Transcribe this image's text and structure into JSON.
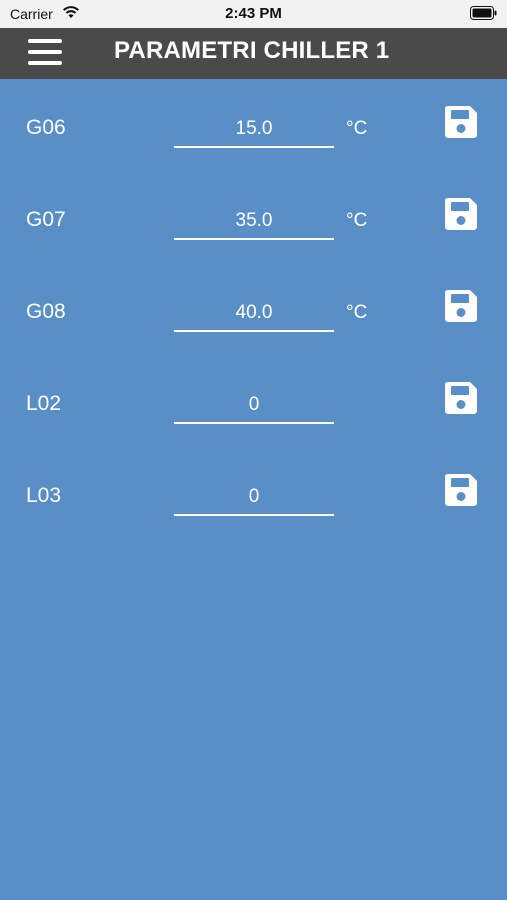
{
  "status_bar": {
    "carrier": "Carrier",
    "time": "2:43 PM",
    "wifi_icon": "wifi-icon",
    "battery_icon": "battery-icon"
  },
  "header": {
    "title": "PARAMETRI CHILLER 1",
    "menu_icon": "hamburger-menu-icon",
    "background": "#4a4a4a"
  },
  "theme": {
    "background": "#5a8ec6",
    "text": "#ffffff"
  },
  "parameters": [
    {
      "label": "G06",
      "value": "15.0",
      "unit": "°C",
      "save_icon": "floppy-disk-icon"
    },
    {
      "label": "G07",
      "value": "35.0",
      "unit": "°C",
      "save_icon": "floppy-disk-icon"
    },
    {
      "label": "G08",
      "value": "40.0",
      "unit": "°C",
      "save_icon": "floppy-disk-icon"
    },
    {
      "label": "L02",
      "value": "0",
      "unit": "",
      "save_icon": "floppy-disk-icon"
    },
    {
      "label": "L03",
      "value": "0",
      "unit": "",
      "save_icon": "floppy-disk-icon"
    }
  ]
}
